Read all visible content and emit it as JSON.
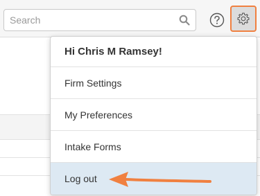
{
  "header": {
    "search": {
      "placeholder": "Search",
      "value": ""
    },
    "help_icon": "question-circle-icon",
    "settings_icon": "gear-icon"
  },
  "dropdown": {
    "greeting": "Hi Chris M Ramsey!",
    "items": [
      {
        "label": "Firm Settings"
      },
      {
        "label": "My Preferences"
      },
      {
        "label": "Intake Forms"
      },
      {
        "label": "Log out",
        "highlighted": true
      }
    ]
  },
  "colors": {
    "accent": "#f08040",
    "highlight_row": "#dde9f3",
    "header_bg": "#f6f6f6"
  }
}
